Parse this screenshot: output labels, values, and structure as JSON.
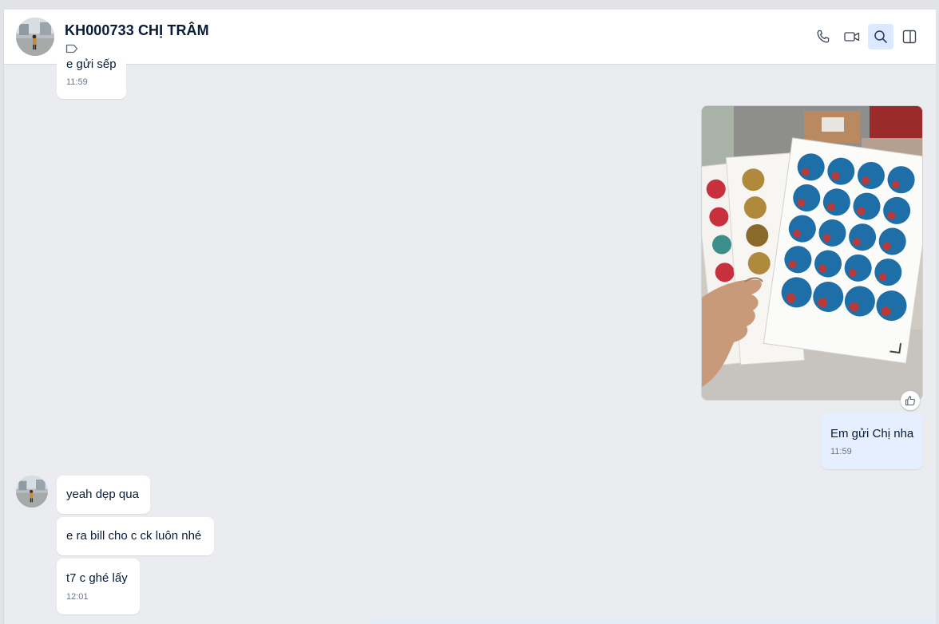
{
  "conversation": {
    "title": "KH000733 CHỊ TRÂM"
  },
  "messages": {
    "top_partial": {
      "text": "e gửi sếp",
      "time": "11:59"
    },
    "mine_text": {
      "text": "Em gửi Chị nha",
      "time": "11:59"
    },
    "incoming": [
      {
        "text": "yeah dẹp qua"
      },
      {
        "text": "e ra bill cho c ck luôn nhé"
      },
      {
        "text": "t7 c ghé lấy",
        "time": "12:01"
      }
    ]
  },
  "icons": {
    "tag": "tag-icon",
    "call": "phone-icon",
    "video": "video-call-icon",
    "search": "search-icon",
    "panel": "side-panel-icon",
    "reaction": "thumbs-up-icon"
  },
  "colors": {
    "chat_background": "#ebecf0",
    "my_bubble": "#e5efff",
    "their_bubble": "#ffffff",
    "active_button": "#dbe8ff"
  }
}
